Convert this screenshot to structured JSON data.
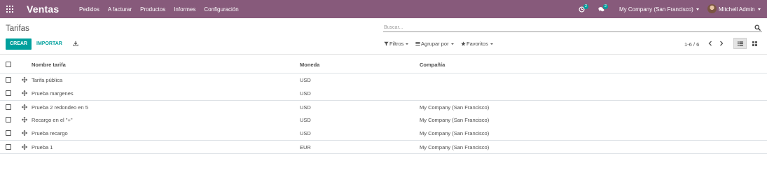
{
  "navbar": {
    "brand": "Ventas",
    "menu": [
      "Pedidos",
      "A facturar",
      "Productos",
      "Informes",
      "Configuración"
    ],
    "activity_count": "2",
    "messages_count": "2",
    "company": "My Company (San Francisco)",
    "user": "Mitchell Admin",
    "color": "#875a7b"
  },
  "control": {
    "title": "Tarifas",
    "search_placeholder": "Buscar...",
    "create_label": "CREAR",
    "import_label": "IMPORTAR",
    "filters_label": "Filtros",
    "groupby_label": "Agrupar por",
    "favorites_label": "Favoritos",
    "pager": "1-6 / 6",
    "accent": "#00a09d"
  },
  "table": {
    "columns": [
      "Nombre tarifa",
      "Moneda",
      "Compañía"
    ],
    "rows": [
      {
        "name": "Tarifa pública",
        "currency": "USD",
        "company": ""
      },
      {
        "name": "Prueba margenes",
        "currency": "USD",
        "company": ""
      },
      {
        "name": "Prueba 2 redondeo en 5",
        "currency": "USD",
        "company": "My Company (San Francisco)"
      },
      {
        "name": "Recargo en el \"+\"",
        "currency": "USD",
        "company": "My Company (San Francisco)"
      },
      {
        "name": "Prueba recargo",
        "currency": "USD",
        "company": "My Company (San Francisco)"
      },
      {
        "name": "Prueba 1",
        "currency": "EUR",
        "company": "My Company (San Francisco)"
      }
    ]
  },
  "icons": {
    "apps": "apps-grid-icon",
    "activity": "clock-icon",
    "messages": "chat-bubbles-icon",
    "search": "search-icon",
    "download": "download-icon",
    "handle": "move-handle-icon",
    "list_view": "list-view-icon",
    "kanban_view": "kanban-view-icon"
  }
}
